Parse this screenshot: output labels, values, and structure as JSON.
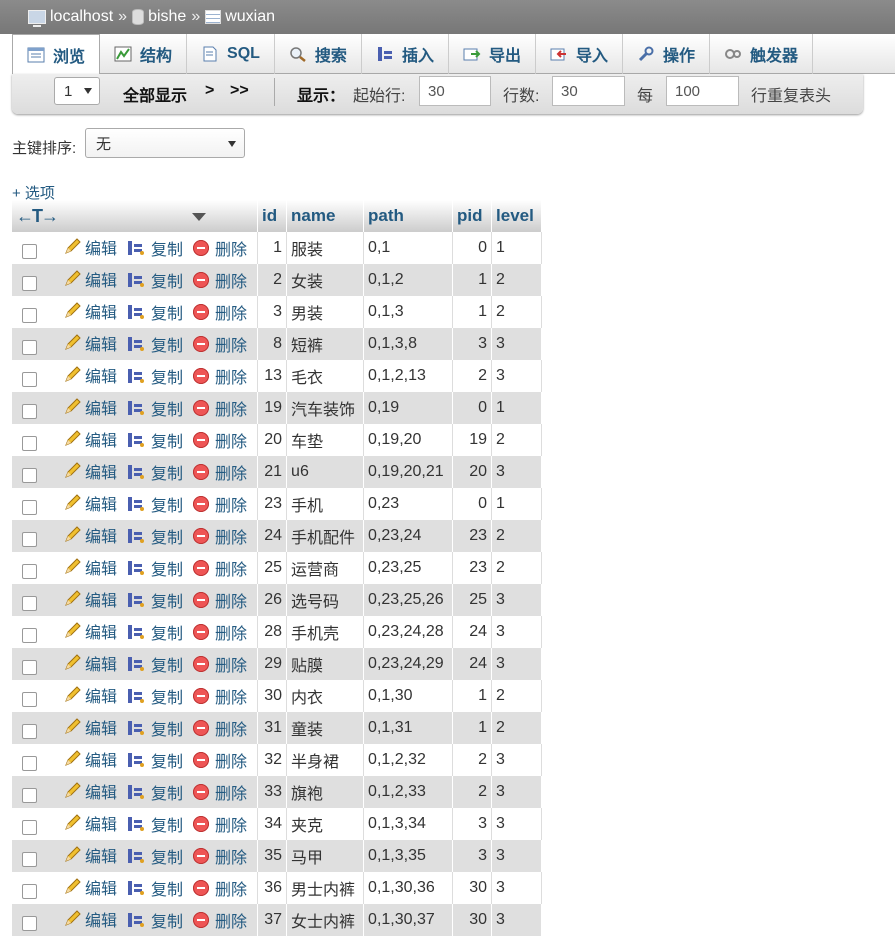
{
  "breadcrumb": {
    "server": "localhost",
    "database": "bishe",
    "table": "wuxian",
    "separator": "»"
  },
  "tabs": [
    {
      "label": "浏览",
      "icon": "browse-icon"
    },
    {
      "label": "结构",
      "icon": "structure-icon"
    },
    {
      "label": "SQL",
      "icon": "sql-icon"
    },
    {
      "label": "搜索",
      "icon": "search-icon"
    },
    {
      "label": "插入",
      "icon": "insert-icon"
    },
    {
      "label": "导出",
      "icon": "export-icon"
    },
    {
      "label": "导入",
      "icon": "import-icon"
    },
    {
      "label": "操作",
      "icon": "wrench-icon"
    },
    {
      "label": "触发器",
      "icon": "trigger-icon"
    }
  ],
  "nav": {
    "page_value": "1",
    "show_all": "全部显示",
    "next": ">",
    "last": ">>",
    "display_label": "显示：",
    "start_row_label": "起始行:",
    "start_row_value": "30",
    "rows_label": "行数:",
    "rows_value": "30",
    "every_label": "每",
    "repeat_value": "100",
    "repeat_label": "行重复表头"
  },
  "sort": {
    "label": "主键排序:",
    "value": "无"
  },
  "options_link": "+ 选项",
  "table": {
    "headers": [
      "id",
      "name",
      "path",
      "pid",
      "level"
    ],
    "actions": {
      "edit": "编辑",
      "copy": "复制",
      "delete": "删除"
    },
    "rows": [
      {
        "id": "1",
        "name": "服装",
        "path": "0,1",
        "pid": "0",
        "level": "1"
      },
      {
        "id": "2",
        "name": "女装",
        "path": "0,1,2",
        "pid": "1",
        "level": "2"
      },
      {
        "id": "3",
        "name": "男装",
        "path": "0,1,3",
        "pid": "1",
        "level": "2"
      },
      {
        "id": "8",
        "name": "短裤",
        "path": "0,1,3,8",
        "pid": "3",
        "level": "3"
      },
      {
        "id": "13",
        "name": "毛衣",
        "path": "0,1,2,13",
        "pid": "2",
        "level": "3"
      },
      {
        "id": "19",
        "name": "汽车装饰",
        "path": "0,19",
        "pid": "0",
        "level": "1"
      },
      {
        "id": "20",
        "name": "车垫",
        "path": "0,19,20",
        "pid": "19",
        "level": "2"
      },
      {
        "id": "21",
        "name": "u6",
        "path": "0,19,20,21",
        "pid": "20",
        "level": "3"
      },
      {
        "id": "23",
        "name": "手机",
        "path": "0,23",
        "pid": "0",
        "level": "1"
      },
      {
        "id": "24",
        "name": "手机配件",
        "path": "0,23,24",
        "pid": "23",
        "level": "2"
      },
      {
        "id": "25",
        "name": "运营商",
        "path": "0,23,25",
        "pid": "23",
        "level": "2"
      },
      {
        "id": "26",
        "name": "选号码",
        "path": "0,23,25,26",
        "pid": "25",
        "level": "3"
      },
      {
        "id": "28",
        "name": "手机壳",
        "path": "0,23,24,28",
        "pid": "24",
        "level": "3"
      },
      {
        "id": "29",
        "name": "贴膜",
        "path": "0,23,24,29",
        "pid": "24",
        "level": "3"
      },
      {
        "id": "30",
        "name": "内衣",
        "path": "0,1,30",
        "pid": "1",
        "level": "2"
      },
      {
        "id": "31",
        "name": "童装",
        "path": "0,1,31",
        "pid": "1",
        "level": "2"
      },
      {
        "id": "32",
        "name": "半身裙",
        "path": "0,1,2,32",
        "pid": "2",
        "level": "3"
      },
      {
        "id": "33",
        "name": "旗袍",
        "path": "0,1,2,33",
        "pid": "2",
        "level": "3"
      },
      {
        "id": "34",
        "name": "夹克",
        "path": "0,1,3,34",
        "pid": "3",
        "level": "3"
      },
      {
        "id": "35",
        "name": "马甲",
        "path": "0,1,3,35",
        "pid": "3",
        "level": "3"
      },
      {
        "id": "36",
        "name": "男士内裤",
        "path": "0,1,30,36",
        "pid": "30",
        "level": "3"
      },
      {
        "id": "37",
        "name": "女士内裤",
        "path": "0,1,30,37",
        "pid": "30",
        "level": "3"
      }
    ]
  }
}
